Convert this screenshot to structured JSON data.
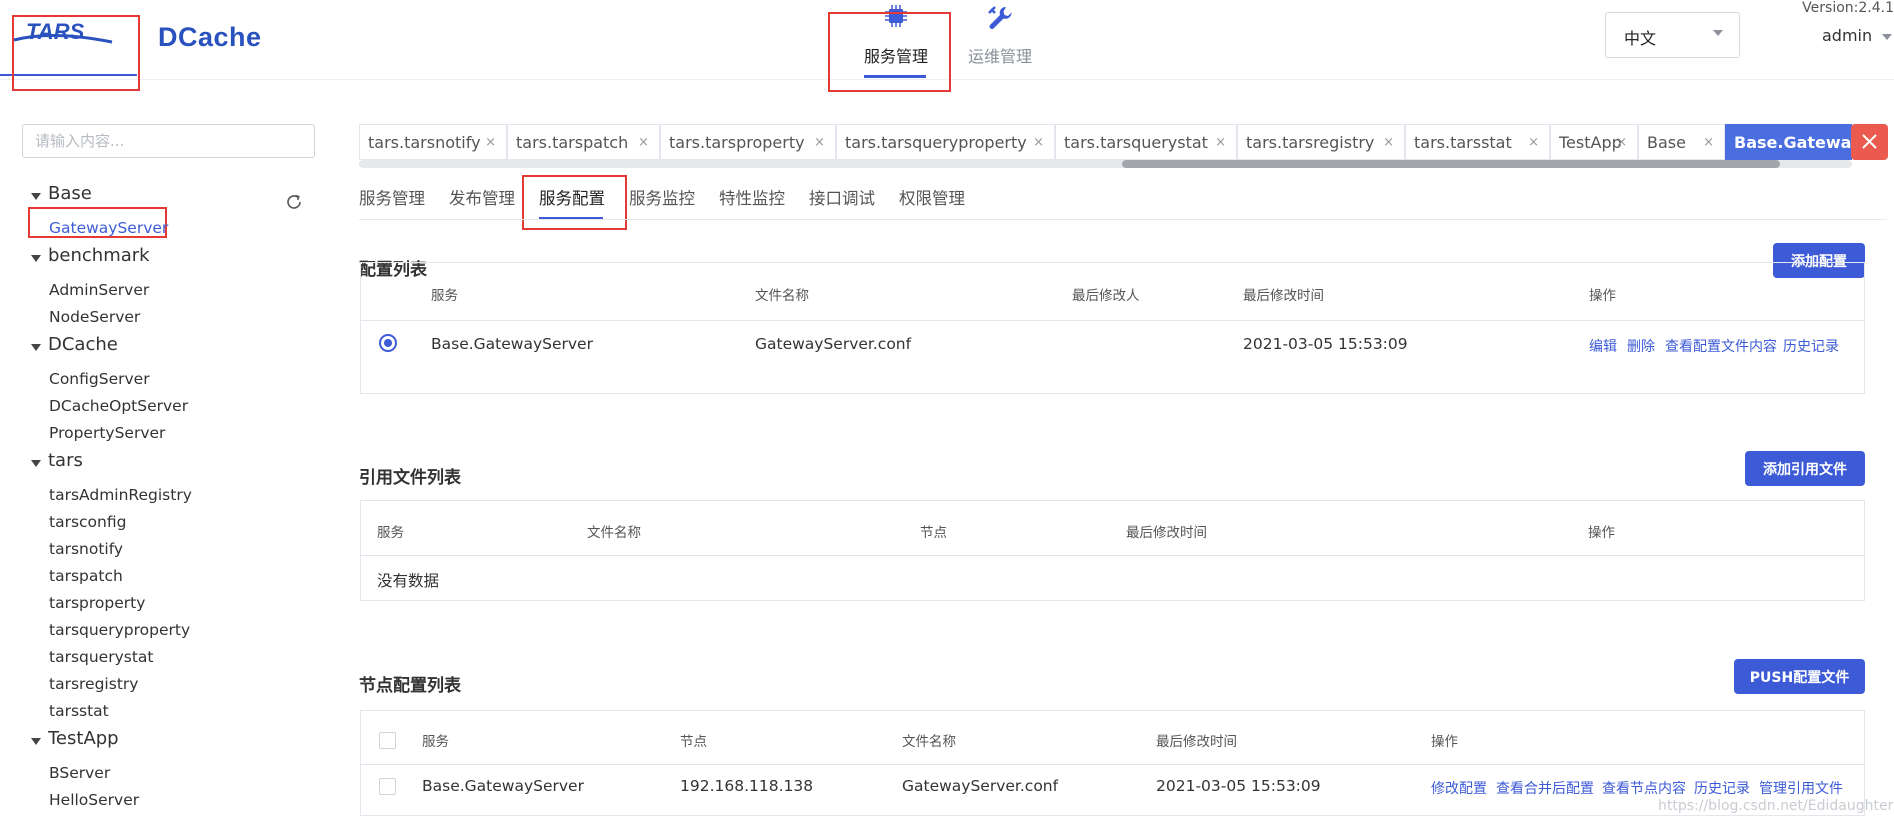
{
  "header": {
    "logo_tars": "TARS",
    "logo_dcache": "DCache",
    "nav": [
      {
        "label": "服务管理",
        "icon": "chip-icon"
      },
      {
        "label": "运维管理",
        "icon": "wrench-icon"
      }
    ],
    "language": "中文",
    "version": "Version:2.4.1",
    "user": "admin"
  },
  "sidebar": {
    "search_placeholder": "请输入内容...",
    "tree": [
      {
        "name": "Base",
        "items": [
          "GatewayServer"
        ]
      },
      {
        "name": "benchmark",
        "items": [
          "AdminServer",
          "NodeServer"
        ]
      },
      {
        "name": "DCache",
        "items": [
          "ConfigServer",
          "DCacheOptServer",
          "PropertyServer"
        ]
      },
      {
        "name": "tars",
        "items": [
          "tarsAdminRegistry",
          "tarsconfig",
          "tarsnotify",
          "tarspatch",
          "tarsproperty",
          "tarsqueryproperty",
          "tarsquerystat",
          "tarsregistry",
          "tarsstat"
        ]
      },
      {
        "name": "TestApp",
        "items": [
          "BServer",
          "HelloServer"
        ]
      }
    ],
    "active_item": "GatewayServer"
  },
  "tabs": [
    {
      "label": "tars.tarsnotify"
    },
    {
      "label": "tars.tarspatch"
    },
    {
      "label": "tars.tarsproperty"
    },
    {
      "label": "tars.tarsqueryproperty"
    },
    {
      "label": "tars.tarsquerystat"
    },
    {
      "label": "tars.tarsregistry"
    },
    {
      "label": "tars.tarsstat"
    },
    {
      "label": "TestApp"
    },
    {
      "label": "Base"
    },
    {
      "label": "Base.GatewayServer",
      "active": true
    }
  ],
  "tab_close_glyph": "×",
  "subtabs": [
    "服务管理",
    "发布管理",
    "服务配置",
    "服务监控",
    "特性监控",
    "接口调试",
    "权限管理"
  ],
  "active_subtab": "服务配置",
  "config_list": {
    "title": "配置列表",
    "add_button": "添加配置",
    "columns": [
      "服务",
      "文件名称",
      "最后修改人",
      "最后修改时间",
      "操作"
    ],
    "rows": [
      {
        "service": "Base.GatewayServer",
        "filename": "GatewayServer.conf",
        "modifier": "",
        "time": "2021-03-05 15:53:09",
        "actions": [
          "编辑",
          "删除",
          "查看配置文件内容",
          "历史记录"
        ]
      }
    ]
  },
  "ref_list": {
    "title": "引用文件列表",
    "add_button": "添加引用文件",
    "columns": [
      "服务",
      "文件名称",
      "节点",
      "最后修改时间",
      "操作"
    ],
    "empty_text": "没有数据"
  },
  "node_list": {
    "title": "节点配置列表",
    "push_button": "PUSH配置文件",
    "columns": [
      "服务",
      "节点",
      "文件名称",
      "最后修改时间",
      "操作"
    ],
    "rows": [
      {
        "service": "Base.GatewayServer",
        "node": "192.168.118.138",
        "filename": "GatewayServer.conf",
        "time": "2021-03-05 15:53:09",
        "actions": [
          "修改配置",
          "查看合并后配置",
          "查看节点内容",
          "历史记录",
          "管理引用文件"
        ]
      }
    ]
  },
  "watermark": "https://blog.csdn.net/Edidaughter",
  "colors": {
    "accent": "#3d5bd6",
    "highlight": "#e53935",
    "close_all": "#ea5a4f"
  }
}
